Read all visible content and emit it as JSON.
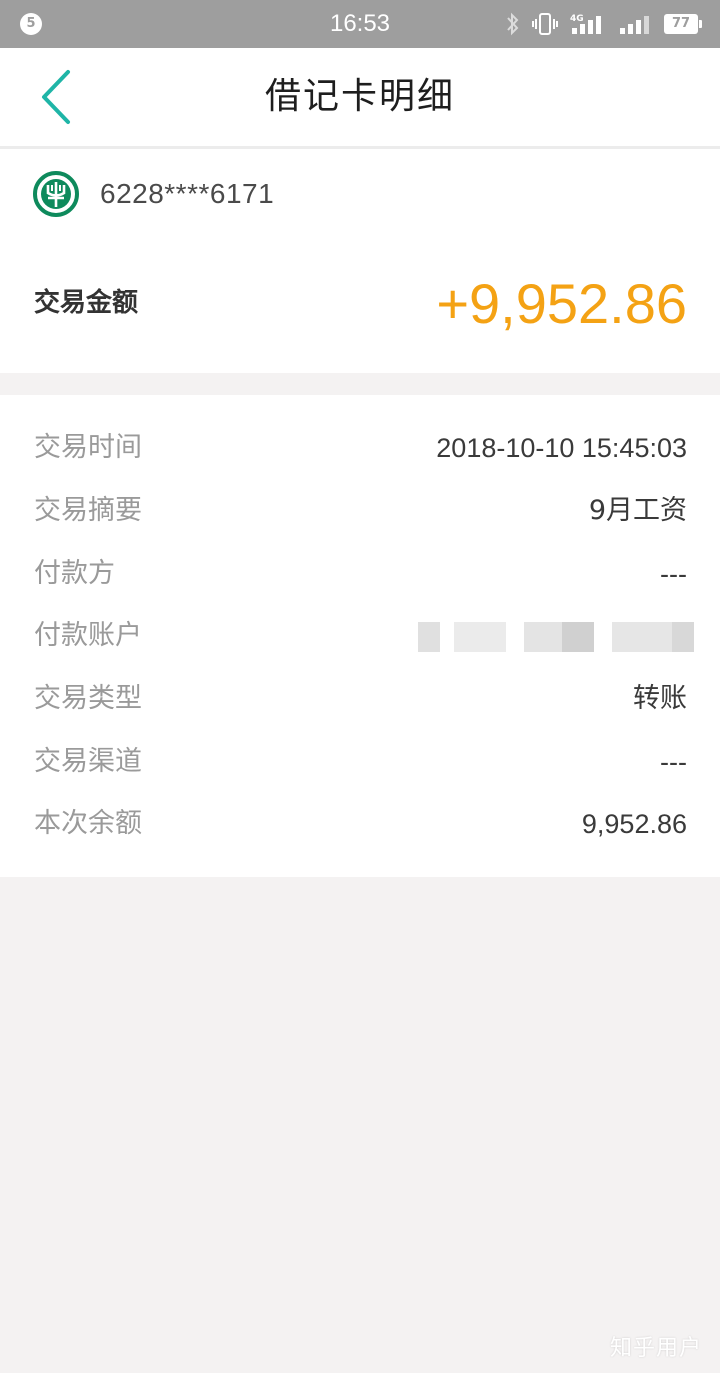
{
  "status_bar": {
    "notification_count": "5",
    "time": "16:53",
    "network_label": "4G",
    "battery_level": "77",
    "icons": [
      "bluetooth-icon",
      "vibrate-icon",
      "signal-4g-icon",
      "signal-icon",
      "battery-icon"
    ]
  },
  "header": {
    "title": "借记卡明细",
    "back_icon": "chevron-left-icon"
  },
  "summary": {
    "bank_logo_icon": "agricultural-bank-logo-icon",
    "card_number": "6228****6171",
    "amount_label": "交易金额",
    "amount_value": "+9,952.86"
  },
  "details": [
    {
      "label": "交易时间",
      "value": "2018-10-10 15:45:03"
    },
    {
      "label": "交易摘要",
      "value": "9月工资"
    },
    {
      "label": "付款方",
      "value": "---"
    },
    {
      "label": "付款账户",
      "value": ""
    },
    {
      "label": "交易类型",
      "value": "转账"
    },
    {
      "label": "交易渠道",
      "value": "---"
    },
    {
      "label": "本次余额",
      "value": "9,952.86"
    }
  ],
  "watermark": "知乎用户",
  "colors": {
    "accent_teal": "#1fb5a7",
    "amount_orange": "#f4a214",
    "bank_green": "#0e8a5c",
    "status_bar_gray": "#9e9e9e",
    "page_background": "#f4f2f2"
  }
}
